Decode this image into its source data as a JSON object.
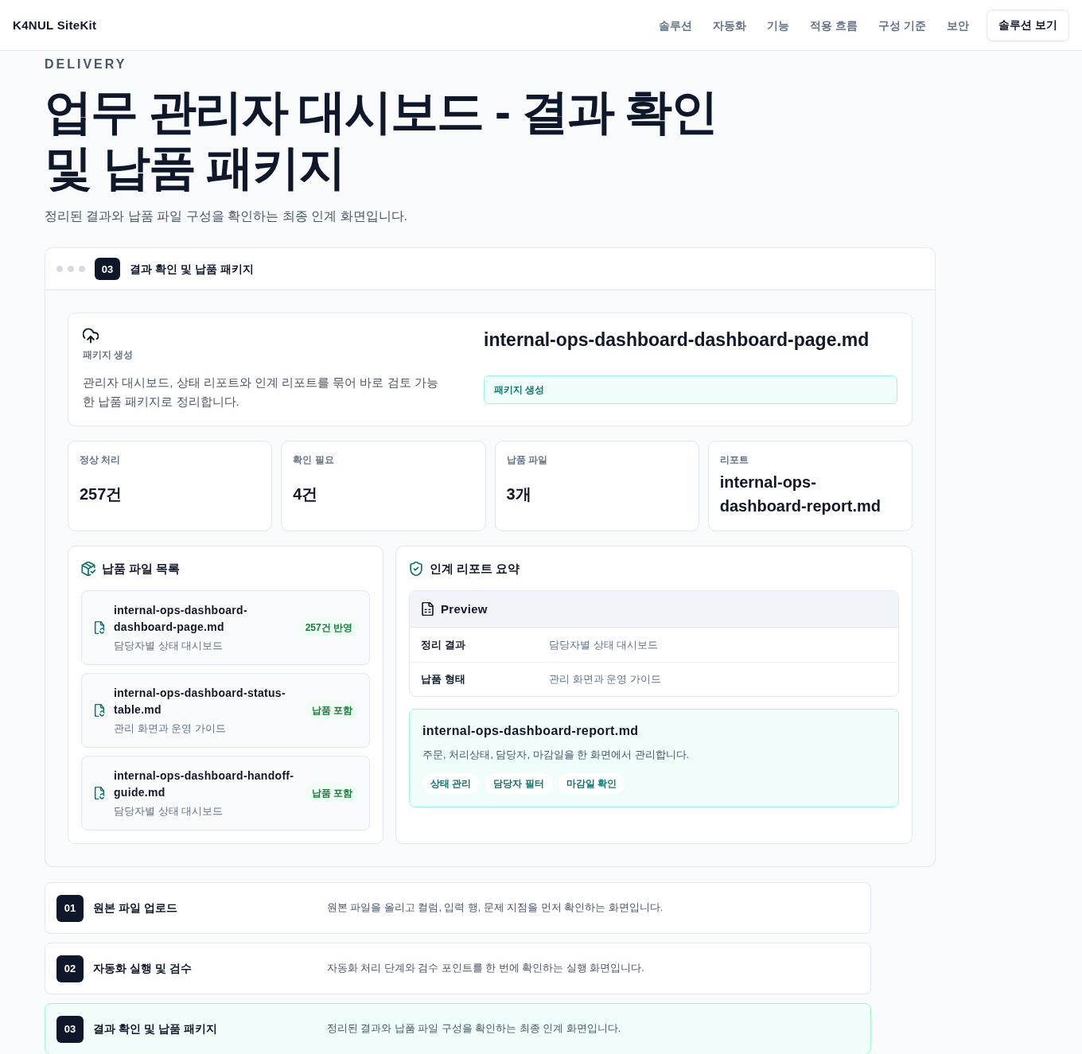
{
  "header": {
    "logo": "K4NUL SiteKit",
    "nav": [
      {
        "label": "솔루션"
      },
      {
        "label": "자동화"
      },
      {
        "label": "기능"
      },
      {
        "label": "적용 흐름"
      },
      {
        "label": "구성 기준"
      },
      {
        "label": "보안"
      }
    ],
    "cta": "솔루션 보기"
  },
  "hero": {
    "eyebrow": "DELIVERY",
    "title": "업무 관리자 대시보드 - 결과 확인 및 납품 패키지",
    "subtitle": "정리된 결과와 납품 파일 구성을 확인하는 최종 인계 화면입니다."
  },
  "panel": {
    "step_number": "03",
    "title": "결과 확인 및 납품 패키지",
    "package": {
      "label": "패키지 생성",
      "description": "관리자 대시보드, 상태 리포트와 인계 리포트를 묶어 바로 검토 가능한 납품 패키지로 정리합니다.",
      "filename": "internal-ops-dashboard-dashboard-page.md",
      "status": "패키지 생성"
    },
    "stats": [
      {
        "label": "정상 처리",
        "value": "257건"
      },
      {
        "label": "확인 필요",
        "value": "4건"
      },
      {
        "label": "납품 파일",
        "value": "3개"
      },
      {
        "label": "리포트",
        "value": "internal-ops-dashboard-report.md"
      }
    ],
    "files": {
      "title": "납품 파일 목록",
      "items": [
        {
          "name": "internal-ops-dashboard-dashboard-page.md",
          "description": "담당자별 상태 대시보드",
          "badge": "257건 반영"
        },
        {
          "name": "internal-ops-dashboard-status-table.md",
          "description": "관리 화면과 운영 가이드",
          "badge": "납품 포함"
        },
        {
          "name": "internal-ops-dashboard-handoff-guide.md",
          "description": "담당자별 상태 대시보드",
          "badge": "납품 포함"
        }
      ]
    },
    "report": {
      "title": "인계 리포트 요약",
      "preview": {
        "title": "Preview",
        "rows": [
          {
            "key": "정리 결과",
            "value": "담당자별 상태 대시보드"
          },
          {
            "key": "납품 형태",
            "value": "관리 화면과 운영 가이드"
          }
        ]
      },
      "highlight": {
        "filename": "internal-ops-dashboard-report.md",
        "description": "주문, 처리상태, 담당자, 마감일을 한 화면에서 관리합니다.",
        "tags": [
          "상태 관리",
          "담당자 필터",
          "마감일 확인"
        ]
      }
    }
  },
  "steps": [
    {
      "number": "01",
      "title": "원본 파일 업로드",
      "description": "원본 파일을 올리고 컬럼, 입력 행, 문제 지점을 먼저 확인하는 화면입니다.",
      "selected": false
    },
    {
      "number": "02",
      "title": "자동화 실행 및 검수",
      "description": "자동화 처리 단계와 검수 포인트를 한 번에 확인하는 실행 화면입니다.",
      "selected": false
    },
    {
      "number": "03",
      "title": "결과 확인 및 납품 패키지",
      "description": "정리된 결과와 납품 파일 구성을 확인하는 최종 인계 화면입니다.",
      "selected": true
    }
  ]
}
